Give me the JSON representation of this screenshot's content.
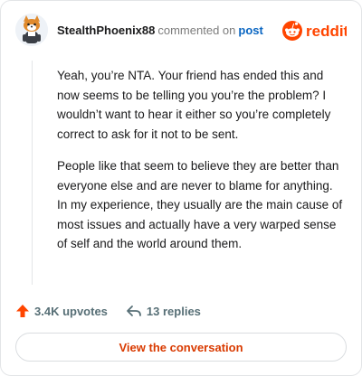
{
  "header": {
    "username": "StealthPhoenix88",
    "action_text": "commented on",
    "post_link": "post",
    "brand_name": "reddit",
    "brand_color": "#ff4500"
  },
  "comment": {
    "paragraphs": [
      "Yeah, you’re NTA. Your friend has ended this and now seems to be telling you you’re the problem? I wouldn’t want to hear it either so you’re completely correct to ask for it not to be sent.",
      "People like that seem to believe they are better than everyone else and are never to blame for anything. In my experience, they usually are the main cause of most issues and actually have a very warped sense of self and the world around them."
    ]
  },
  "actions": {
    "upvotes": "3.4K upvotes",
    "upvote_icon": "upvote-arrow-icon",
    "upvote_color": "#ff4500",
    "replies": "13 replies",
    "reply_icon": "reply-arrow-icon"
  },
  "cta": {
    "label": "View the conversation",
    "color": "#d93a00"
  }
}
